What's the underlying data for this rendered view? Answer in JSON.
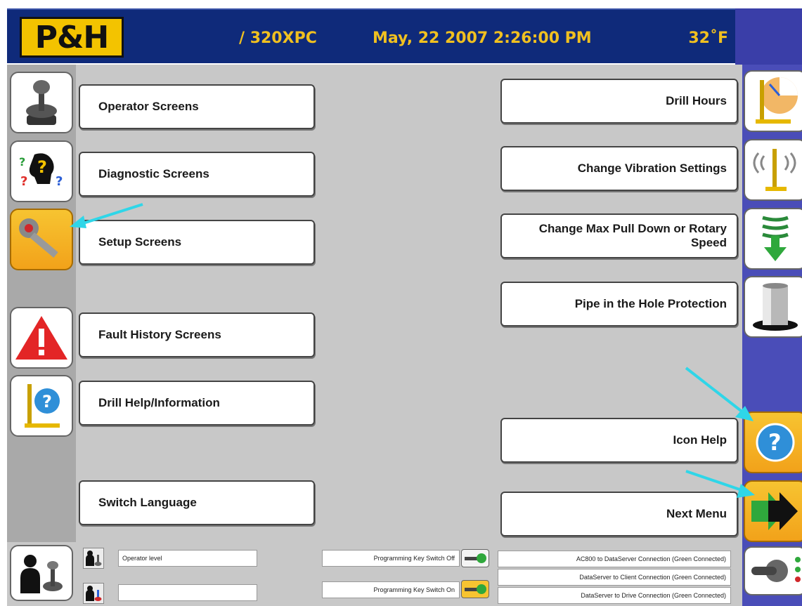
{
  "header": {
    "logo_text": "P&H",
    "model": "/ 320XPC",
    "datetime": "May, 22 2007 2:26:00 PM",
    "temperature": "32˚F"
  },
  "left_menu": [
    {
      "label": "Operator Screens",
      "icon": "joystick-icon"
    },
    {
      "label": "Diagnostic Screens",
      "icon": "question-head-icon"
    },
    {
      "label": "Setup Screens",
      "icon": "wrench-icon"
    },
    {
      "label": "Fault History Screens",
      "icon": "warning-icon"
    },
    {
      "label": "Drill Help/Information",
      "icon": "drill-help-icon"
    },
    {
      "label": "Switch Language",
      "icon": null
    }
  ],
  "right_menu": [
    {
      "label": "Drill Hours",
      "icon": "drill-hours-icon"
    },
    {
      "label": "Change Vibration Settings",
      "icon": "vibration-icon"
    },
    {
      "label": "Change Max Pull Down or Rotary Speed",
      "icon": "pulldown-speed-icon"
    },
    {
      "label": "Pipe in the Hole Protection",
      "icon": "pipe-icon"
    },
    {
      "label": "Icon Help",
      "icon": "question-icon"
    },
    {
      "label": "Next Menu",
      "icon": "next-arrow-icon"
    }
  ],
  "status": {
    "operator_level": "Operator  level",
    "operator_level_2": "",
    "key_switch_off": "Programming Key Switch Off",
    "key_switch_on": "Programming Key Switch On",
    "conn_ac800": "AC800 to DataServer Connection  (Green Connected)",
    "conn_client": "DataServer to Client Connection  (Green Connected)",
    "conn_drive": "DataServer to Drive Connection  (Green Connected)"
  },
  "colors": {
    "header_bg": "#0f2a7a",
    "header_text": "#f0c020",
    "accent_gold": "#f2a21a",
    "right_panel": "#4a4db8",
    "annotation_arrow": "#2fd6e8"
  }
}
